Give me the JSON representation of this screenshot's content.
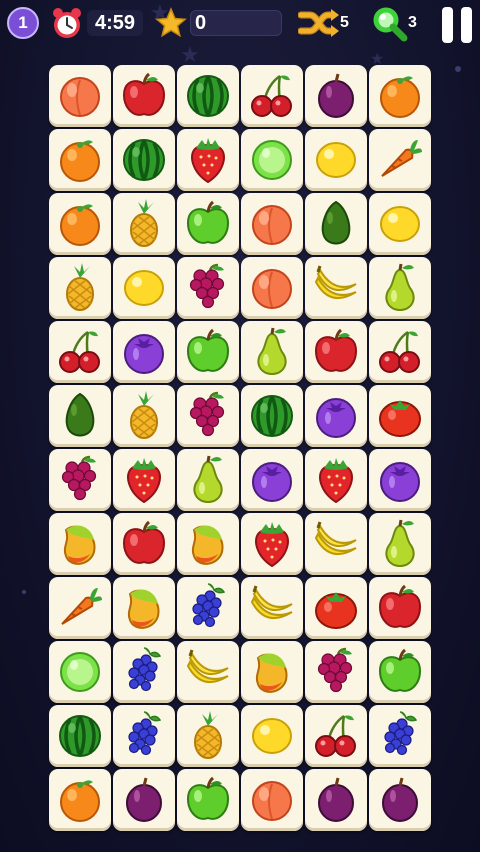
{
  "hud": {
    "level": "1",
    "timer": "4:59",
    "score": "0",
    "shuffle_count": "5",
    "hint_count": "3"
  },
  "board": {
    "rows": [
      [
        "peach",
        "apple",
        "watermelon",
        "cherry",
        "plum",
        "orange"
      ],
      [
        "orange",
        "watermelon",
        "strawberry",
        "lime",
        "lemon",
        "carrot"
      ],
      [
        "orange",
        "pineapple",
        "green-apple",
        "peach",
        "avocado",
        "lemon"
      ],
      [
        "pineapple",
        "lemon",
        "grape",
        "peach",
        "banana",
        "pear"
      ],
      [
        "cherry",
        "blueberry",
        "green-apple",
        "pear",
        "apple",
        "cherry"
      ],
      [
        "avocado",
        "pineapple",
        "grape",
        "watermelon",
        "blueberry",
        "tomato"
      ],
      [
        "grape",
        "strawberry",
        "pear",
        "blueberry",
        "strawberry",
        "blueberry"
      ],
      [
        "mango",
        "apple",
        "mango",
        "strawberry",
        "banana",
        "pear"
      ],
      [
        "carrot",
        "mango",
        "blackberry",
        "banana",
        "tomato",
        "apple"
      ],
      [
        "lime",
        "blackberry",
        "banana",
        "mango",
        "grape",
        "green-apple"
      ],
      [
        "watermelon",
        "blackberry",
        "pineapple",
        "lemon",
        "cherry",
        "blackberry"
      ],
      [
        "orange",
        "plum",
        "green-apple",
        "peach",
        "plum",
        "plum"
      ]
    ]
  },
  "icons": {
    "level_badge": "level-badge",
    "alarm": "alarm-clock-icon",
    "star": "star-icon",
    "shuffle": "shuffle-icon",
    "hint": "magnifier-icon",
    "pause": "pause-icon"
  },
  "colors": {
    "background": "#13142e",
    "tile": "#fbf6e3",
    "level_badge": "#7a4fd6",
    "star": "#f5b829",
    "shuffle": "#f2b12a",
    "hint": "#3fd13a",
    "alarm": "#e8374a"
  }
}
